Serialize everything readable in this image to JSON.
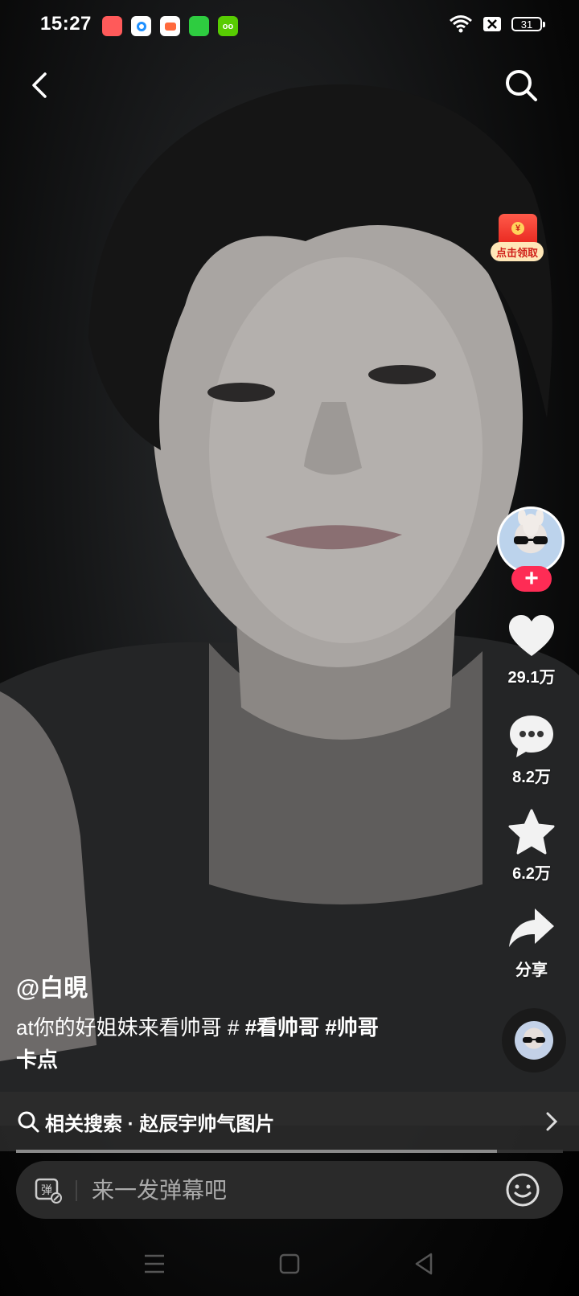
{
  "status_bar": {
    "time": "15:27",
    "battery": "31",
    "app_icons": [
      {
        "name": "app-icon-1",
        "color": "#ff5a5a"
      },
      {
        "name": "app-icon-2",
        "color": "#1e90ff"
      },
      {
        "name": "app-icon-3",
        "color": "#ff6a3d"
      },
      {
        "name": "app-icon-4",
        "color": "#2ecc40"
      },
      {
        "name": "app-icon-5",
        "color": "#58cc02"
      }
    ]
  },
  "red_envelope": {
    "label": "点击领取",
    "coin": "¥"
  },
  "actions": {
    "likes": "29.1万",
    "comments": "8.2万",
    "favorites": "6.2万",
    "share": "分享"
  },
  "follow": {
    "label": "+"
  },
  "post": {
    "author": "@白晛",
    "caption_text": "at你的好姐妹来看帅哥 # ",
    "tag1": "#看帅哥",
    "tag2": "#帅哥",
    "caption_tail": "卡点"
  },
  "related_search": {
    "text": "相关搜索 · 赵辰宇帅气图片"
  },
  "progress": {
    "fraction": 0.88
  },
  "danmaku": {
    "placeholder": "来一发弹幕吧",
    "icon_label": "弹"
  },
  "colors": {
    "accent": "#fe2c55",
    "envelope": "#e7231b"
  }
}
